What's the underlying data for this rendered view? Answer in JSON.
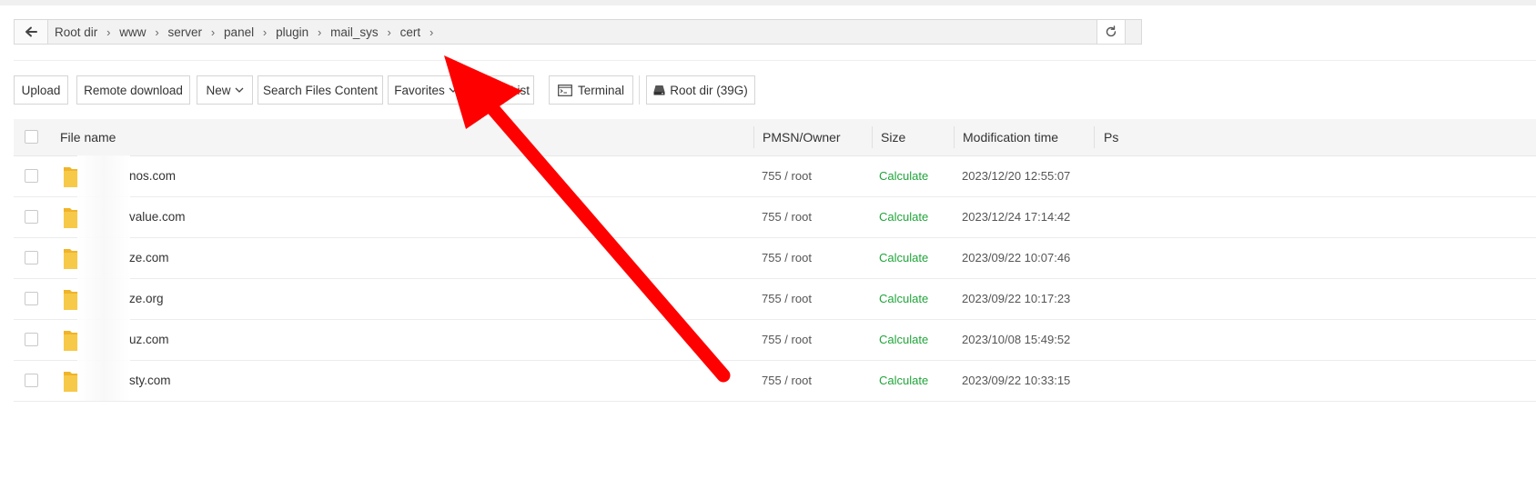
{
  "breadcrumb": {
    "items": [
      "Root dir",
      "www",
      "server",
      "panel",
      "plugin",
      "mail_sys",
      "cert"
    ],
    "separator": "›"
  },
  "toolbar": {
    "upload": "Upload",
    "remote_download": "Remote download",
    "new": "New",
    "search_files_content": "Search Files Content",
    "favorites": "Favorites",
    "list": "List",
    "terminal": "Terminal",
    "root_dir": "Root dir (39G)"
  },
  "table": {
    "headers": {
      "file_name": "File name",
      "permission": "PMSN/Owner",
      "size": "Size",
      "modification_time": "Modification time",
      "ps": "Ps"
    },
    "rows": [
      {
        "name": "nos.com",
        "permission": "755 / root",
        "size": "Calculate",
        "modified": "2023/12/20 12:55:07"
      },
      {
        "name": "value.com",
        "permission": "755 / root",
        "size": "Calculate",
        "modified": "2023/12/24 17:14:42"
      },
      {
        "name": "ze.com",
        "permission": "755 / root",
        "size": "Calculate",
        "modified": "2023/09/22 10:07:46"
      },
      {
        "name": "ze.org",
        "permission": "755 / root",
        "size": "Calculate",
        "modified": "2023/09/22 10:17:23"
      },
      {
        "name": "uz.com",
        "permission": "755 / root",
        "size": "Calculate",
        "modified": "2023/10/08 15:49:52"
      },
      {
        "name": "sty.com",
        "permission": "755 / root",
        "size": "Calculate",
        "modified": "2023/09/22 10:33:15"
      }
    ]
  },
  "colors": {
    "accent_green": "#20a53a",
    "annotation_arrow": "#ff0000",
    "folder": "#f7c948"
  },
  "icons": [
    "back-arrow-icon",
    "chevron-right-icon",
    "refresh-icon",
    "chevron-down-icon",
    "terminal-icon",
    "disk-icon",
    "folder-icon",
    "annotation-arrow"
  ]
}
